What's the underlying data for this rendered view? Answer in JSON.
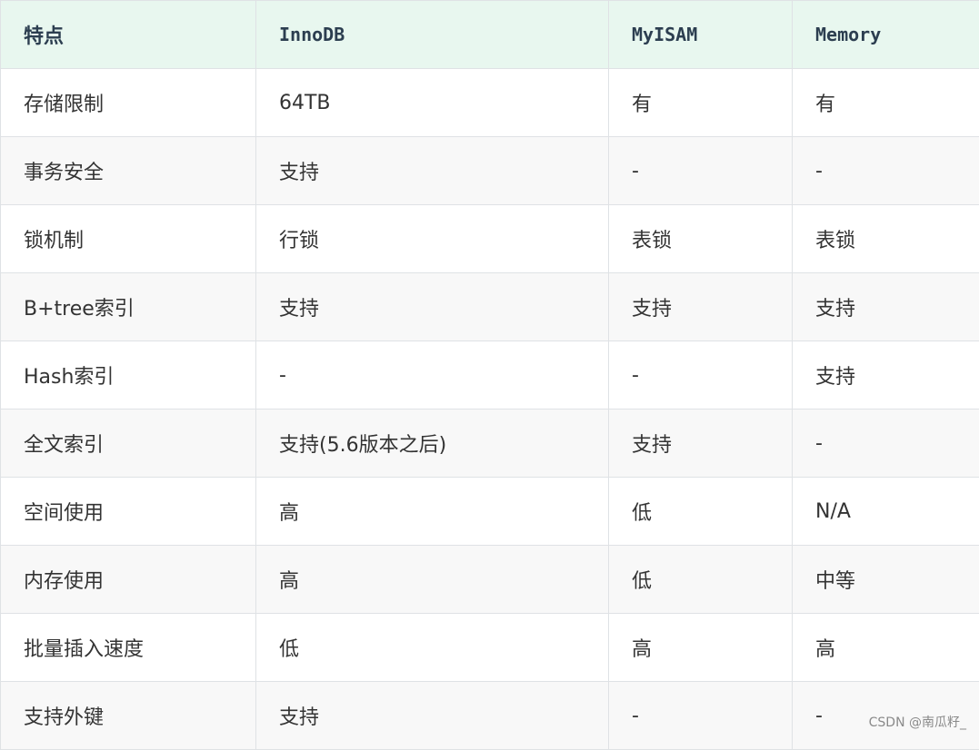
{
  "table": {
    "headers": [
      "特点",
      "InnoDB",
      "MyISAM",
      "Memory"
    ],
    "rows": [
      [
        "存储限制",
        "64TB",
        "有",
        "有"
      ],
      [
        "事务安全",
        "支持",
        "-",
        "-"
      ],
      [
        "锁机制",
        "行锁",
        "表锁",
        "表锁"
      ],
      [
        "B+tree索引",
        "支持",
        "支持",
        "支持"
      ],
      [
        "Hash索引",
        "-",
        "-",
        "支持"
      ],
      [
        "全文索引",
        "支持(5.6版本之后)",
        "支持",
        "-"
      ],
      [
        "空间使用",
        "高",
        "低",
        "N/A"
      ],
      [
        "内存使用",
        "高",
        "低",
        "中等"
      ],
      [
        "批量插入速度",
        "低",
        "高",
        "高"
      ],
      [
        "支持外键",
        "支持",
        "-",
        "-"
      ]
    ]
  },
  "watermark": "CSDN @南瓜籽_"
}
